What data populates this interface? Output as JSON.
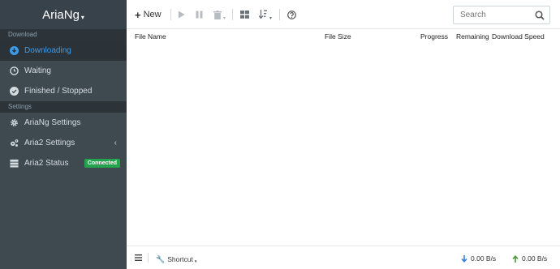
{
  "brand": {
    "title": "AriaNg"
  },
  "sidebar": {
    "sections": {
      "download": "Download",
      "settings": "Settings"
    },
    "items": [
      {
        "label": "Downloading"
      },
      {
        "label": "Waiting"
      },
      {
        "label": "Finished / Stopped"
      },
      {
        "label": "AriaNg Settings"
      },
      {
        "label": "Aria2 Settings"
      },
      {
        "label": "Aria2 Status",
        "badge": "Connected"
      }
    ]
  },
  "toolbar": {
    "new_label": "New"
  },
  "search": {
    "placeholder": "Search"
  },
  "table": {
    "headers": [
      "File Name",
      "File Size",
      "Progress",
      "Remaining",
      "Download Speed"
    ]
  },
  "footer": {
    "shortcut_label": "Shortcut",
    "download_speed": "0.00 B/s",
    "upload_speed": "0.00 B/s"
  },
  "colors": {
    "sidebar": "#3f4950",
    "accent": "#3c9be8",
    "connected": "#23a34e"
  }
}
